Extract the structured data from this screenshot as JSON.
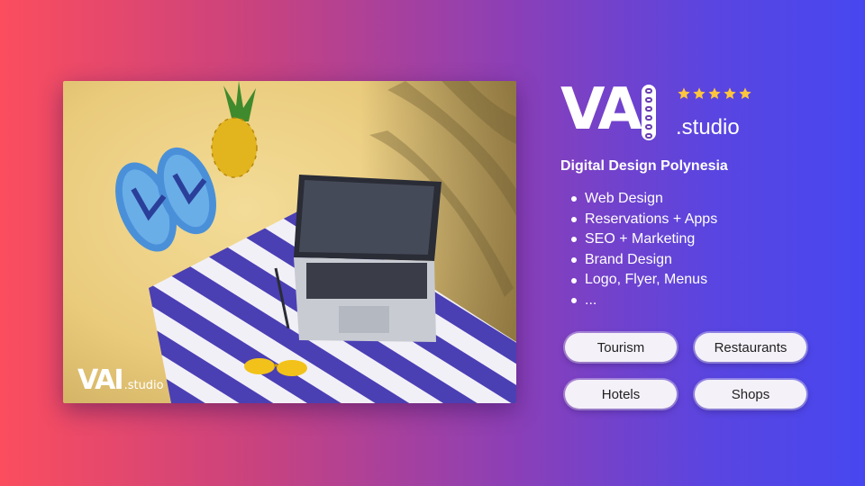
{
  "photo": {
    "watermark_letters": "VAI",
    "watermark_suffix": ".studio"
  },
  "logo": {
    "letters": "VA",
    "suffix": ".studio",
    "rating_stars": 5,
    "star_color": "#ffc53d"
  },
  "headline": "Digital Design Polynesia",
  "services": [
    "Web Design",
    "Reservations + Apps",
    "SEO + Marketing",
    "Brand Design",
    "Logo, Flyer, Menus",
    "..."
  ],
  "categories": [
    "Tourism",
    "Restaurants",
    "Hotels",
    "Shops"
  ],
  "colors": {
    "gradient_left": "#fb4d5e",
    "gradient_right": "#4747f0",
    "pill_background": "#f4f1f8",
    "towel_stripe": "#4b3fb4"
  }
}
